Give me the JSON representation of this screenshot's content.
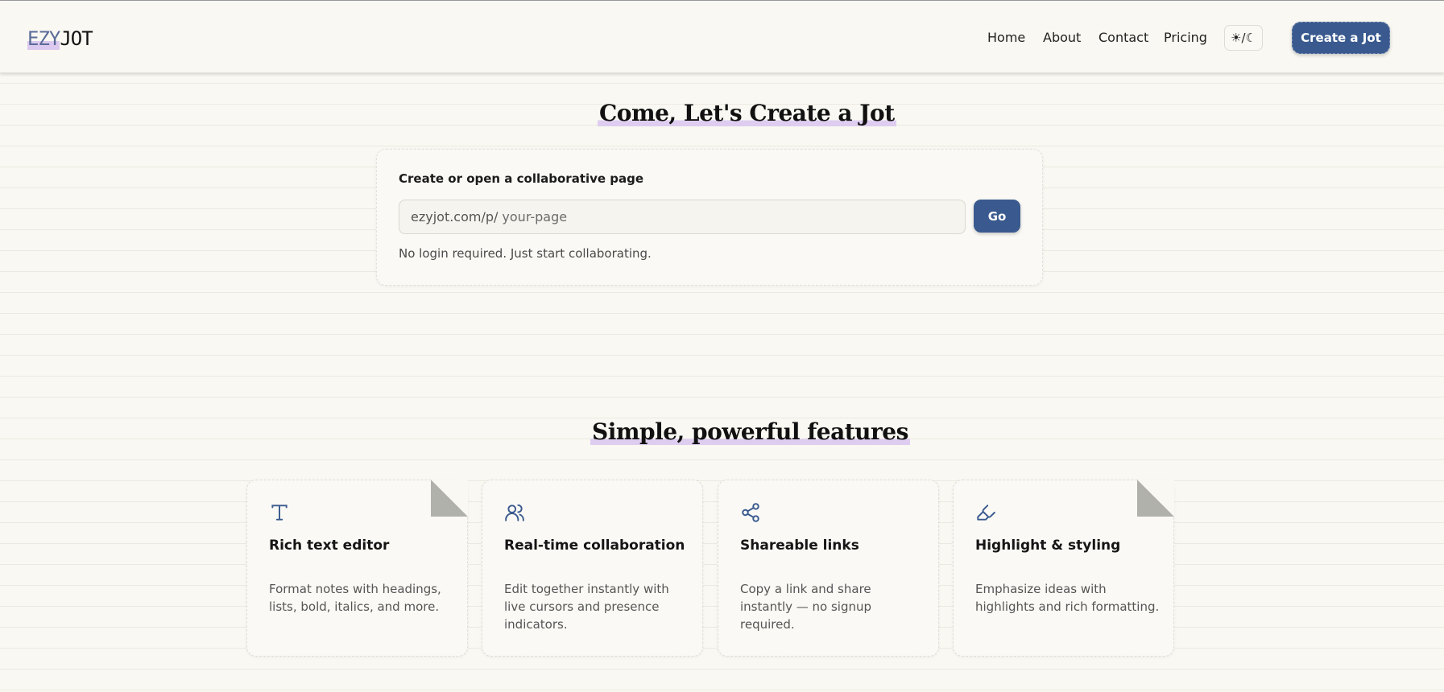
{
  "brand": {
    "logo_part1": "EZY",
    "logo_part2": "JOT"
  },
  "nav": {
    "links": [
      "Home",
      "About",
      "Contact",
      "Pricing"
    ],
    "theme_toggle": "☀/☾",
    "cta": "Create a Jot"
  },
  "hero": {
    "title": "Come, Let's Create a Jot",
    "label": "Create or open a collaborative page",
    "url_prefix": "ezyjot.com/p/",
    "url_placeholder": "your-page",
    "go_label": "Go",
    "note": "No login required. Just start collaborating."
  },
  "features": {
    "title": "Simple, powerful features",
    "items": [
      {
        "icon": "text-icon",
        "title": "Rich text editor",
        "description": "Format notes with headings, lists, bold, italics, and more.",
        "folded": true
      },
      {
        "icon": "users-icon",
        "title": "Real-time collaboration",
        "description": "Edit together instantly with live cursors and presence indicators.",
        "folded": false
      },
      {
        "icon": "share-icon",
        "title": "Shareable links",
        "description": "Copy a link and share instantly — no signup required.",
        "folded": false
      },
      {
        "icon": "highlighter-icon",
        "title": "Highlight & styling",
        "description": "Emphasize ideas with highlights and rich formatting.",
        "folded": true
      }
    ]
  },
  "colors": {
    "accent": "#3a5a8f",
    "highlight": "#decdf0",
    "paper": "#f9f8f2"
  }
}
